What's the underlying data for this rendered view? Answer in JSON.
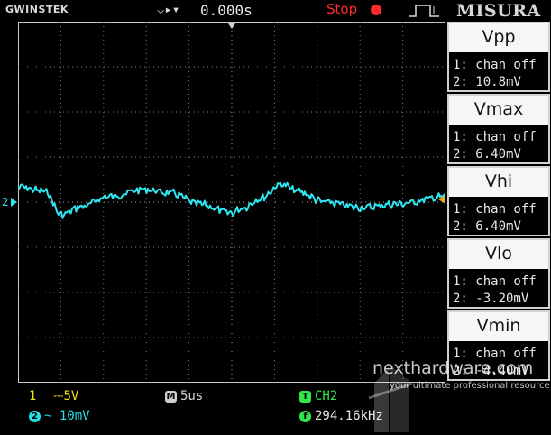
{
  "top_bar": {
    "brand": "GWINSTEK",
    "trigger_icon": "trigger-select-icon",
    "trigger_time": "0.000s",
    "run_state": "Stop",
    "run_state_icon": "stop-icon",
    "edge_icon": "rising-edge-icon",
    "mode": "MISURA"
  },
  "waveform": {
    "channel_marker": "2",
    "trace_color": "#2ee6f0",
    "grid_divisions": {
      "x": 10,
      "y": 8
    }
  },
  "measurements": [
    {
      "name": "Vpp",
      "ch1": "1: chan off",
      "ch2": "2: 10.8mV"
    },
    {
      "name": "Vmax",
      "ch1": "1: chan off",
      "ch2": "2: 6.40mV"
    },
    {
      "name": "Vhi",
      "ch1": "1: chan off",
      "ch2": "2: 6.40mV"
    },
    {
      "name": "Vlo",
      "ch1": "1: chan off",
      "ch2": "2: -3.20mV"
    },
    {
      "name": "Vmin",
      "ch1": "1: chan off",
      "ch2": "2: -4.40mV"
    }
  ],
  "status_bar": {
    "ch1_badge": "1",
    "ch1_scale": "5V",
    "ch1_coupling_icon": "dc-coupling-icon",
    "ch2_badge": "2",
    "ch2_scale": "10mV",
    "ch2_coupling_icon": "ac-coupling-icon",
    "timebase_badge": "M",
    "timebase": "5us",
    "trigger_badge": "T",
    "trigger_source": "CH2",
    "freq_badge": "f",
    "frequency": "294.16kHz"
  },
  "watermark": {
    "site": "nexthardware.com",
    "tagline": "your ultimate professional resource"
  },
  "colors": {
    "ch1": "#f2e21a",
    "ch2": "#22e0e8",
    "stop": "#ff2a2a",
    "trigger": "#33e64a"
  }
}
